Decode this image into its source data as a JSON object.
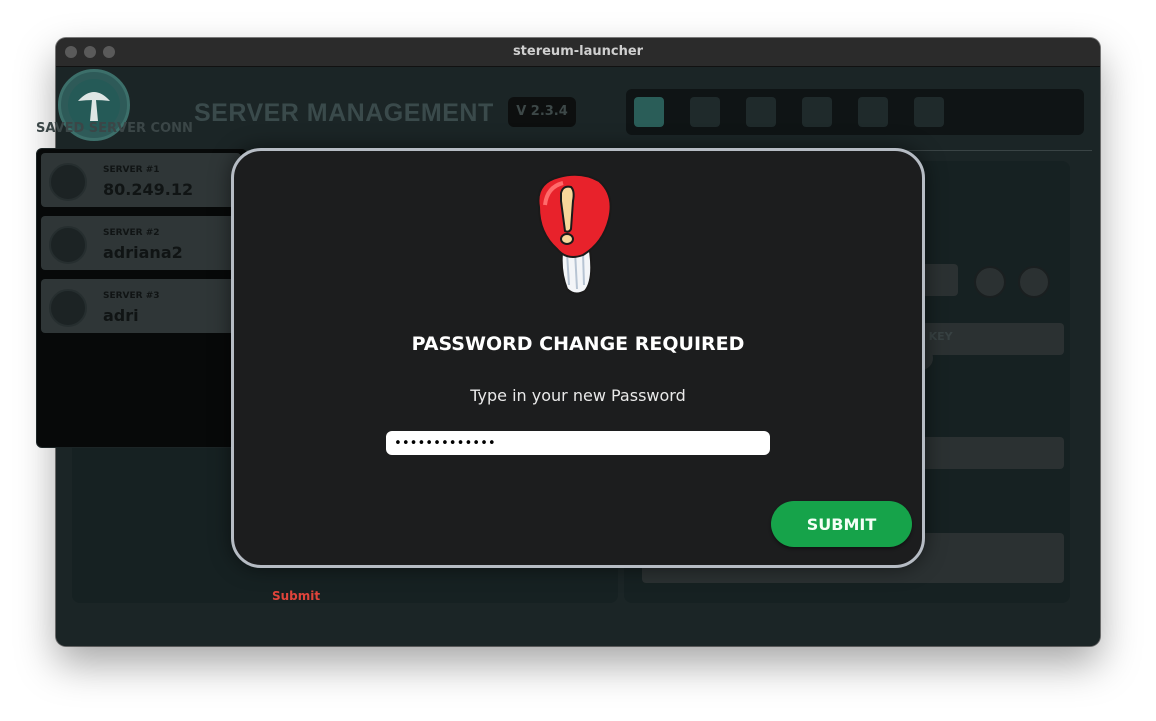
{
  "window": {
    "title": "stereum-launcher"
  },
  "header": {
    "title": "SERVER MANAGEMENT",
    "version": "V 2.3.4"
  },
  "saved_connections": {
    "title": "SAVED SERVER CONN",
    "servers": [
      {
        "number": "SERVER #1",
        "name": "80.249.12"
      },
      {
        "number": "SERVER #2",
        "name": "adriana2"
      },
      {
        "number": "SERVER #3",
        "name": "adri"
      }
    ]
  },
  "connection_form": {
    "ssh_key_label": "USE SSH KEY"
  },
  "bottom": {
    "submit_label": "Submit"
  },
  "modal": {
    "title": "PASSWORD CHANGE REQUIRED",
    "subtitle": "Type in your new Password",
    "password_value": "•••••••••••••",
    "submit_label": "SUBMIT"
  },
  "colors": {
    "accent_green": "#16a34a",
    "modal_background": "#1c1d1e",
    "modal_border": "#b6bcc4",
    "warning_red": "#e0443b"
  }
}
